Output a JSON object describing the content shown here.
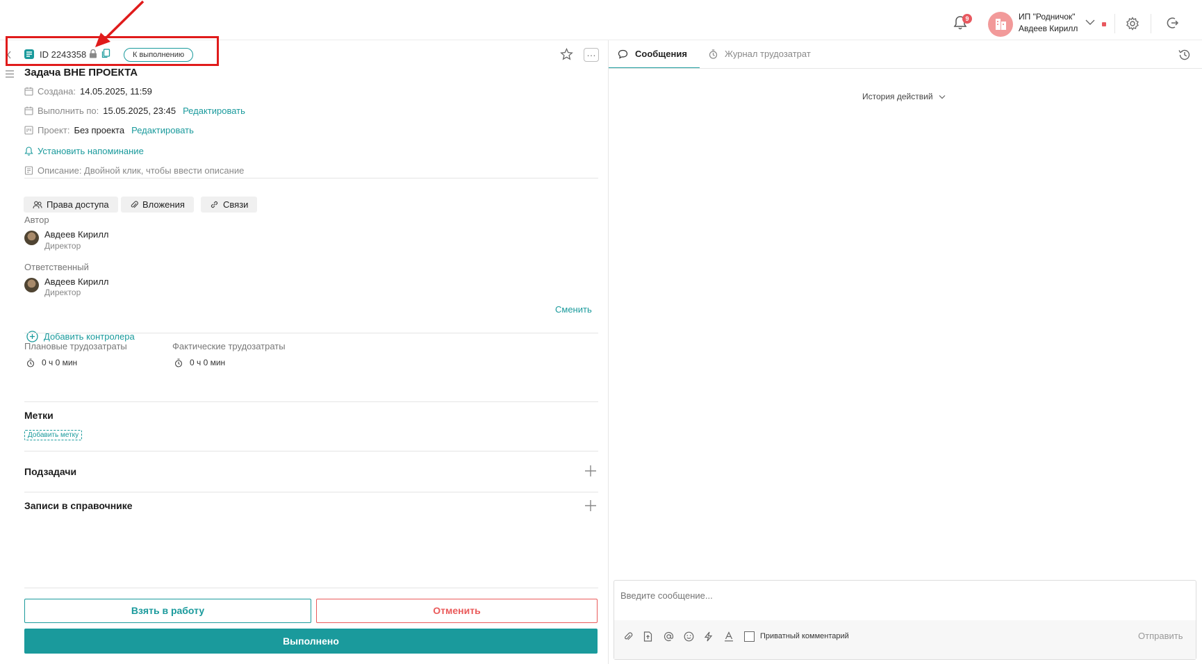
{
  "header": {
    "notifications_count": "9",
    "org_name": "ИП \"Родничок\"",
    "user_name": "Авдеев Кирилл"
  },
  "task": {
    "id_label": "ID 2243358",
    "status": "К выполнению",
    "title": "Задача ВНЕ ПРОЕКТА",
    "created_label": "Создана:",
    "created_value": "14.05.2025, 11:59",
    "due_label": "Выполнить по:",
    "due_value": "15.05.2025, 23:45",
    "edit_link": "Редактировать",
    "project_label": "Проект:",
    "project_value": "Без проекта",
    "reminder_link": "Установить напоминание",
    "description_placeholder": "Описание: Двойной клик, чтобы ввести описание"
  },
  "chips": {
    "access": "Права доступа",
    "attachments": "Вложения",
    "links": "Связи"
  },
  "author": {
    "section": "Автор",
    "name": "Авдеев Кирилл",
    "role": "Директор"
  },
  "responsible": {
    "section": "Ответственный",
    "name": "Авдеев Кирилл",
    "role": "Директор",
    "change_link": "Сменить"
  },
  "add_controller": "Добавить контролера",
  "labor": {
    "planned_label": "Плановые трудозатраты",
    "planned_value": "0 ч 0 мин",
    "actual_label": "Фактические трудозатраты",
    "actual_value": "0 ч 0 мин"
  },
  "tags": {
    "heading": "Метки",
    "add_tag": "Добавить метку"
  },
  "subtasks_heading": "Подзадачи",
  "directory_heading": "Записи в справочнике",
  "actions": {
    "take": "Взять в работу",
    "cancel": "Отменить",
    "done": "Выполнено"
  },
  "right_panel": {
    "tab_messages": "Сообщения",
    "tab_log": "Журнал трудозатрат",
    "history_dropdown": "История действий",
    "composer_placeholder": "Введите сообщение...",
    "private_comment": "Приватный комментарий",
    "send": "Отправить"
  },
  "colors": {
    "accent": "#1a9a9c",
    "danger": "#ea5a5a",
    "highlight_frame": "#e01b1b"
  }
}
